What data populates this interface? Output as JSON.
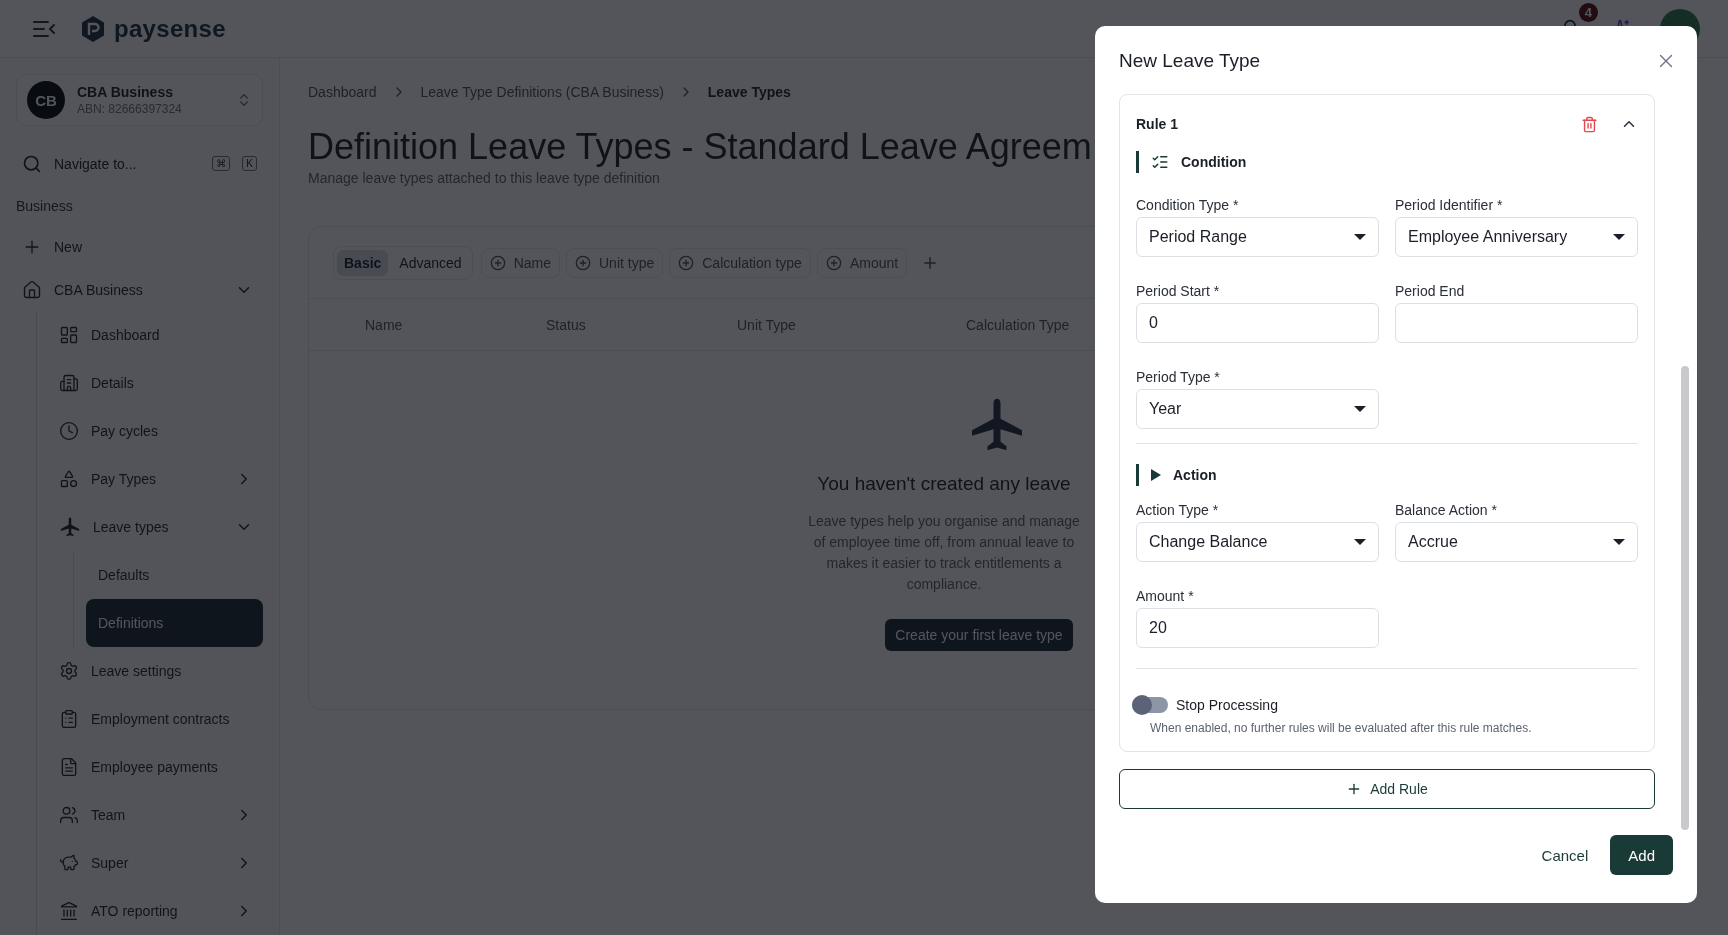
{
  "header": {
    "brand": "paysense",
    "notification_count": "4"
  },
  "sidebar": {
    "business": {
      "initials": "CB",
      "name": "CBA Business",
      "abn": "ABN: 82666397324"
    },
    "search": {
      "placeholder": "Navigate to...",
      "keys": [
        "⌘",
        "K"
      ]
    },
    "section": "Business",
    "items": [
      {
        "label": "New",
        "selected": false
      },
      {
        "label": "CBA Business",
        "selected": false,
        "expanded": true,
        "children": [
          {
            "label": "Dashboard",
            "selected": false
          },
          {
            "label": "Details",
            "selected": false
          },
          {
            "label": "Pay cycles",
            "selected": false
          },
          {
            "label": "Pay Types",
            "selected": false,
            "expanded": false
          },
          {
            "label": "Leave types",
            "selected": false,
            "expanded": true,
            "children": [
              {
                "label": "Defaults",
                "selected": false
              },
              {
                "label": "Definitions",
                "selected": true
              }
            ]
          },
          {
            "label": "Leave settings",
            "selected": false
          },
          {
            "label": "Employment contracts",
            "selected": false
          },
          {
            "label": "Employee payments",
            "selected": false
          },
          {
            "label": "Team",
            "selected": false,
            "expanded": false
          },
          {
            "label": "Super",
            "selected": false,
            "expanded": false
          },
          {
            "label": "ATO reporting",
            "selected": false,
            "expanded": false
          }
        ]
      }
    ]
  },
  "main": {
    "breadcrumbs": [
      "Dashboard",
      "Leave Type Definitions (CBA Business)",
      "Leave Types"
    ],
    "title": "Definition Leave Types - Standard Leave Agreem",
    "subtitle": "Manage leave types attached to this leave type definition",
    "modes": [
      {
        "label": "Basic",
        "selected": true
      },
      {
        "label": "Advanced",
        "selected": false
      }
    ],
    "filters": [
      "Name",
      "Unit type",
      "Calculation type",
      "Amount"
    ],
    "columns": [
      "Name",
      "Status",
      "Unit Type",
      "Calculation Type"
    ],
    "empty_state": {
      "title": "You haven't created any leave",
      "lines": [
        "Leave types help you organise and manage",
        "of employee time off, from annual leave to",
        "makes it easier to track entitlements a",
        "compliance."
      ],
      "button": "Create your first leave type"
    }
  },
  "modal": {
    "title": "New Leave Type",
    "rules": [
      {
        "title": "Rule 1",
        "expanded": true,
        "sections": [
          {
            "kind": "condition",
            "title": "Condition",
            "fields": [
              {
                "kind": "select",
                "label": "Condition Type *",
                "value": "Period Range"
              },
              {
                "kind": "select",
                "label": "Period Identifier *",
                "value": "Employee Anniversary"
              },
              {
                "kind": "text",
                "label": "Period Start *",
                "value": "0"
              },
              {
                "kind": "text",
                "label": "Period End"
              },
              {
                "kind": "select",
                "label": "Period Type *",
                "value": "Year"
              }
            ]
          },
          {
            "kind": "action",
            "title": "Action",
            "fields": [
              {
                "kind": "select",
                "label": "Action Type *",
                "value": "Change Balance"
              },
              {
                "kind": "select",
                "label": "Balance Action *",
                "value": "Accrue"
              },
              {
                "kind": "text",
                "label": "Amount *",
                "value": "20"
              }
            ]
          }
        ],
        "stop_processing": {
          "label": "Stop Processing",
          "hint": "When enabled, no further rules will be evaluated after this rule matches.",
          "on": false
        }
      }
    ],
    "add_rule": "Add Rule",
    "buttons": {
      "cancel": "Cancel",
      "add": "Add"
    }
  }
}
